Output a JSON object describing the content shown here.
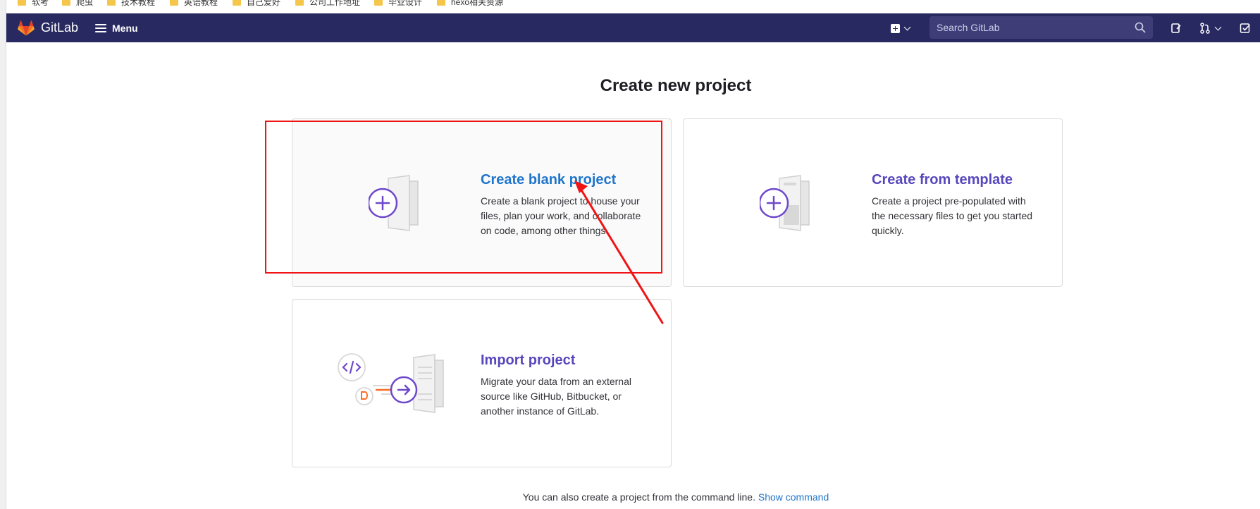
{
  "bookmarks": [
    {
      "label": "软考"
    },
    {
      "label": "爬虫"
    },
    {
      "label": "技术教程"
    },
    {
      "label": "英语教程"
    },
    {
      "label": "自己爱好"
    },
    {
      "label": "公司工作地址"
    },
    {
      "label": "毕业设计"
    },
    {
      "label": "hexo相关资源"
    }
  ],
  "navbar": {
    "brand": "GitLab",
    "menu_label": "Menu",
    "search_placeholder": "Search GitLab",
    "bg_color": "#292961"
  },
  "page": {
    "title": "Create new project"
  },
  "cards": {
    "blank": {
      "title": "Create blank project",
      "description": "Create a blank project to house your files, plan your work, and collaborate on code, among other things."
    },
    "template": {
      "title": "Create from template",
      "description": "Create a project pre-populated with the necessary files to get you started quickly."
    },
    "import": {
      "title": "Import project",
      "description": "Migrate your data from an external source like GitHub, Bitbucket, or another instance of GitLab."
    }
  },
  "footer": {
    "text": "You can also create a project from the command line.",
    "link": "Show command"
  },
  "annotation": {
    "highlight_color": "#f01414"
  }
}
